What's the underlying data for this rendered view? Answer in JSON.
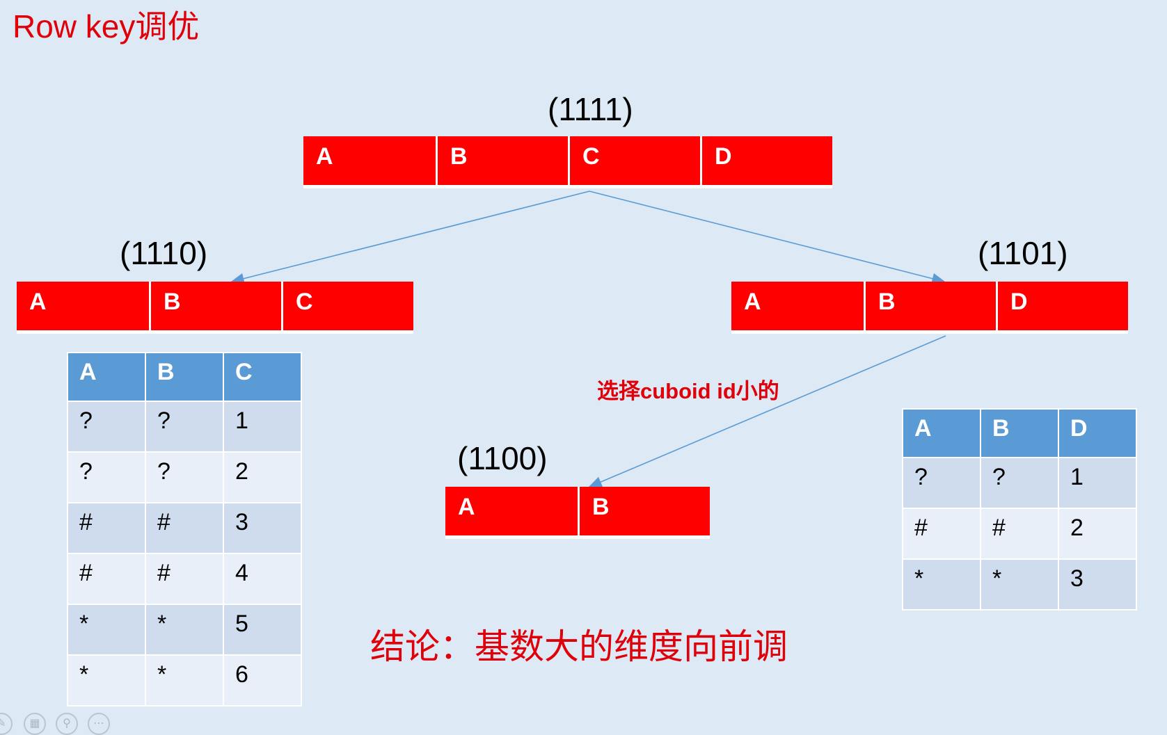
{
  "title": "Row key调优",
  "cuboids": {
    "root": {
      "id": "(1111)",
      "dims": [
        "A",
        "B",
        "C",
        "D"
      ]
    },
    "left": {
      "id": "(1110)",
      "dims": [
        "A",
        "B",
        "C"
      ]
    },
    "right": {
      "id": "(1101)",
      "dims": [
        "A",
        "B",
        "D"
      ]
    },
    "child": {
      "id": "(1100)",
      "dims": [
        "A",
        "B"
      ]
    }
  },
  "table_left": {
    "headers": [
      "A",
      "B",
      "C"
    ],
    "rows": [
      [
        "?",
        "?",
        "1"
      ],
      [
        "?",
        "?",
        "2"
      ],
      [
        "#",
        "#",
        "3"
      ],
      [
        "#",
        "#",
        "4"
      ],
      [
        "*",
        "*",
        "5"
      ],
      [
        "*",
        "*",
        "6"
      ]
    ]
  },
  "table_right": {
    "headers": [
      "A",
      "B",
      "D"
    ],
    "rows": [
      [
        "?",
        "?",
        "1"
      ],
      [
        "#",
        "#",
        "2"
      ],
      [
        "*",
        "*",
        "3"
      ]
    ]
  },
  "note": "选择cuboid id小的",
  "conclusion": "结论：基数大的维度向前调",
  "colors": {
    "bar": "#ff0000",
    "header": "#5b9bd5",
    "accent_text": "#e0000a",
    "arrow": "#5b9bd5"
  },
  "controls": [
    "pen-icon",
    "slides-icon",
    "zoom-icon",
    "more-icon"
  ]
}
